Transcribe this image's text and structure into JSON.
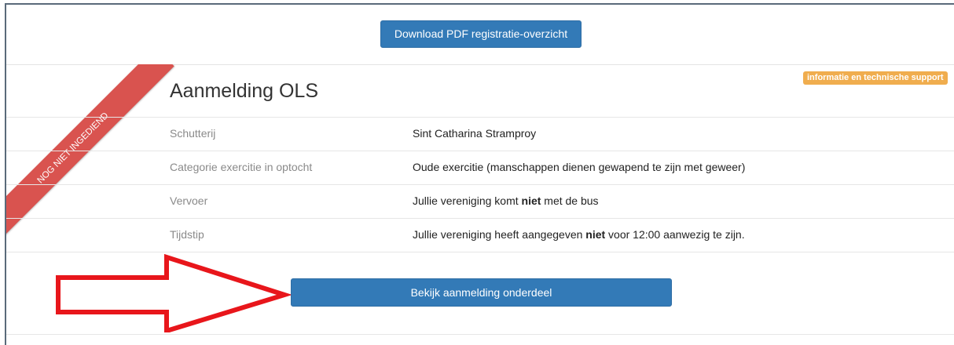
{
  "header": {
    "download_label": "Download PDF registratie-overzicht"
  },
  "ribbon": {
    "text": "NOG NIET INGEDIEND",
    "color": "#d9534f"
  },
  "section": {
    "title": "Aanmelding OLS",
    "support_badge": "informatie en technische support",
    "badge_color": "#f0ad4e"
  },
  "rows": [
    {
      "label": "Schutterij",
      "value_pre": "Sint Catharina Stramproy",
      "value_bold": "",
      "value_post": ""
    },
    {
      "label": "Categorie exercitie in optocht",
      "value_pre": "Oude exercitie (manschappen dienen gewapend te zijn met geweer)",
      "value_bold": "",
      "value_post": ""
    },
    {
      "label": "Vervoer",
      "value_pre": "Jullie vereniging komt ",
      "value_bold": "niet",
      "value_post": " met de bus"
    },
    {
      "label": "Tijdstip",
      "value_pre": "Jullie vereniging heeft aangegeven ",
      "value_bold": "niet",
      "value_post": " voor 12:00 aanwezig te zijn."
    }
  ],
  "footer": {
    "view_label": "Bekijk aanmelding onderdeel",
    "button_color": "#337ab7"
  },
  "annotation": {
    "arrow_color": "#e8161b"
  }
}
